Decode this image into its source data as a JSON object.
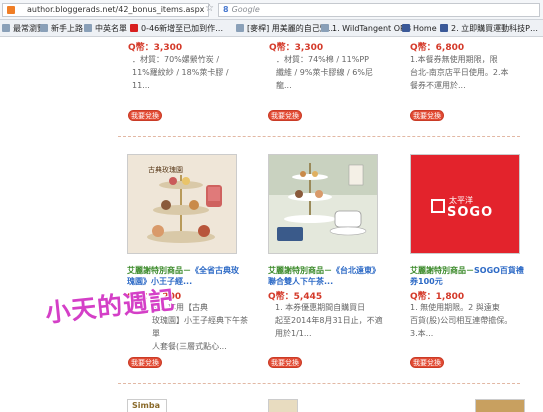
{
  "browser": {
    "url": "author.bloggerads.net/42_bonus_items.aspx",
    "search_engine": "Google",
    "search_placeholder": "Google",
    "bookmarks": [
      {
        "label": "最常瀏覽",
        "icon": "folder-icon",
        "color": "#8aa0b8"
      },
      {
        "label": "新手上路",
        "icon": "page-icon",
        "color": "#8aa0b8"
      },
      {
        "label": "中英名單",
        "icon": "page-icon",
        "color": "#8aa0b8"
      },
      {
        "label": "0-46新增至已加到作…",
        "icon": "youtube-icon",
        "color": "#d81f1f"
      },
      {
        "label": "[麥桿] 用美麗的自己短…",
        "icon": "page-icon",
        "color": "#8aa0b8"
      },
      {
        "label": "1. WildTangent ORB",
        "icon": "page-icon",
        "color": "#8aa0b8"
      },
      {
        "label": "Home",
        "icon": "facebook-icon",
        "color": "#3b5998"
      },
      {
        "label": "2. 立即購買運動科技P…",
        "icon": "facebook-icon",
        "color": "#3b5998"
      }
    ]
  },
  "row1": [
    {
      "price": "Q幣：3,300",
      "desc": [
        "．材質：70%嫘縈竹炭 /",
        "11%羅紋紗 / 18%萊卡膠 /",
        "11..."
      ],
      "button": "我要兌換"
    },
    {
      "price": "Q幣：3,300",
      "desc": [
        "．材質：74%棉 / 11%PP",
        "纖維 / 9%萊卡膠線 / 6%尼",
        "龍..."
      ],
      "button": "我要兌換"
    },
    {
      "price": "Q幣：6,800",
      "desc": [
        "1.本餐券無使用期限，限",
        "台北-南京店平日使用。2.本",
        "餐券不運用於..."
      ],
      "button": "我要兌換"
    }
  ],
  "row2": [
    {
      "title_prefix": "艾麗謝特別商品－",
      "title": "《全省古典玫瑰園》小王子經...",
      "price": "Q幣：6,200",
      "desc": [
        "雙人享用【古典",
        "玫瑰園】小王子經典下午茶單",
        "人套餐(三層式點心..."
      ],
      "button": "我要兌換",
      "thumb_label": "古典玫瑰園"
    },
    {
      "title_prefix": "艾麗謝特別商品－",
      "title": "《台北遠東》聯合雙人下午茶...",
      "price": "Q幣：5,445",
      "desc": [
        "1. 本券優惠期間自購買日",
        "起至2014年8月31日止，不適",
        "用於1/1..."
      ],
      "button": "我要兌換",
      "thumb_label": ""
    },
    {
      "title_prefix": "艾麗謝特別商品－",
      "title": "SOGO百貨禮券100元",
      "price": "Q幣：1,800",
      "desc": [
        "1. 無使用期限。2 與遠東",
        "百貨(股)公司相互連帶擔保。",
        "3.本..."
      ],
      "button": "我要兌換",
      "thumb_label": "SOGO",
      "thumb_label_zh": "太平洋"
    }
  ],
  "watermark": "小天的週記",
  "bottom_row_partial": [
    "Simba",
    "",
    ""
  ]
}
